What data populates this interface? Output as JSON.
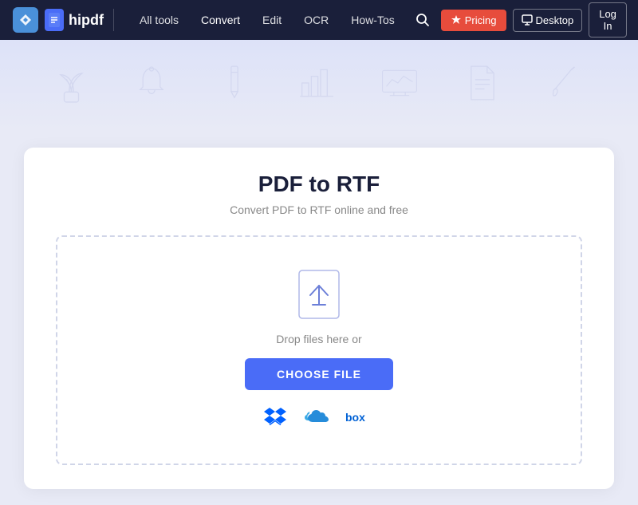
{
  "navbar": {
    "brand": "hipdf",
    "links": [
      {
        "id": "all-tools",
        "label": "All tools"
      },
      {
        "id": "convert",
        "label": "Convert"
      },
      {
        "id": "edit",
        "label": "Edit"
      },
      {
        "id": "ocr",
        "label": "OCR"
      },
      {
        "id": "how-tos",
        "label": "How-Tos"
      }
    ],
    "pricing_label": "Pricing",
    "desktop_label": "Desktop",
    "login_label": "Log In"
  },
  "hero": {
    "title": "PDF to RTF",
    "subtitle": "Convert PDF to RTF online and free"
  },
  "upload": {
    "drop_text": "Drop files here or",
    "choose_label": "CHOOSE FILE",
    "cloud_services": [
      "Dropbox",
      "OneDrive",
      "Box"
    ]
  }
}
